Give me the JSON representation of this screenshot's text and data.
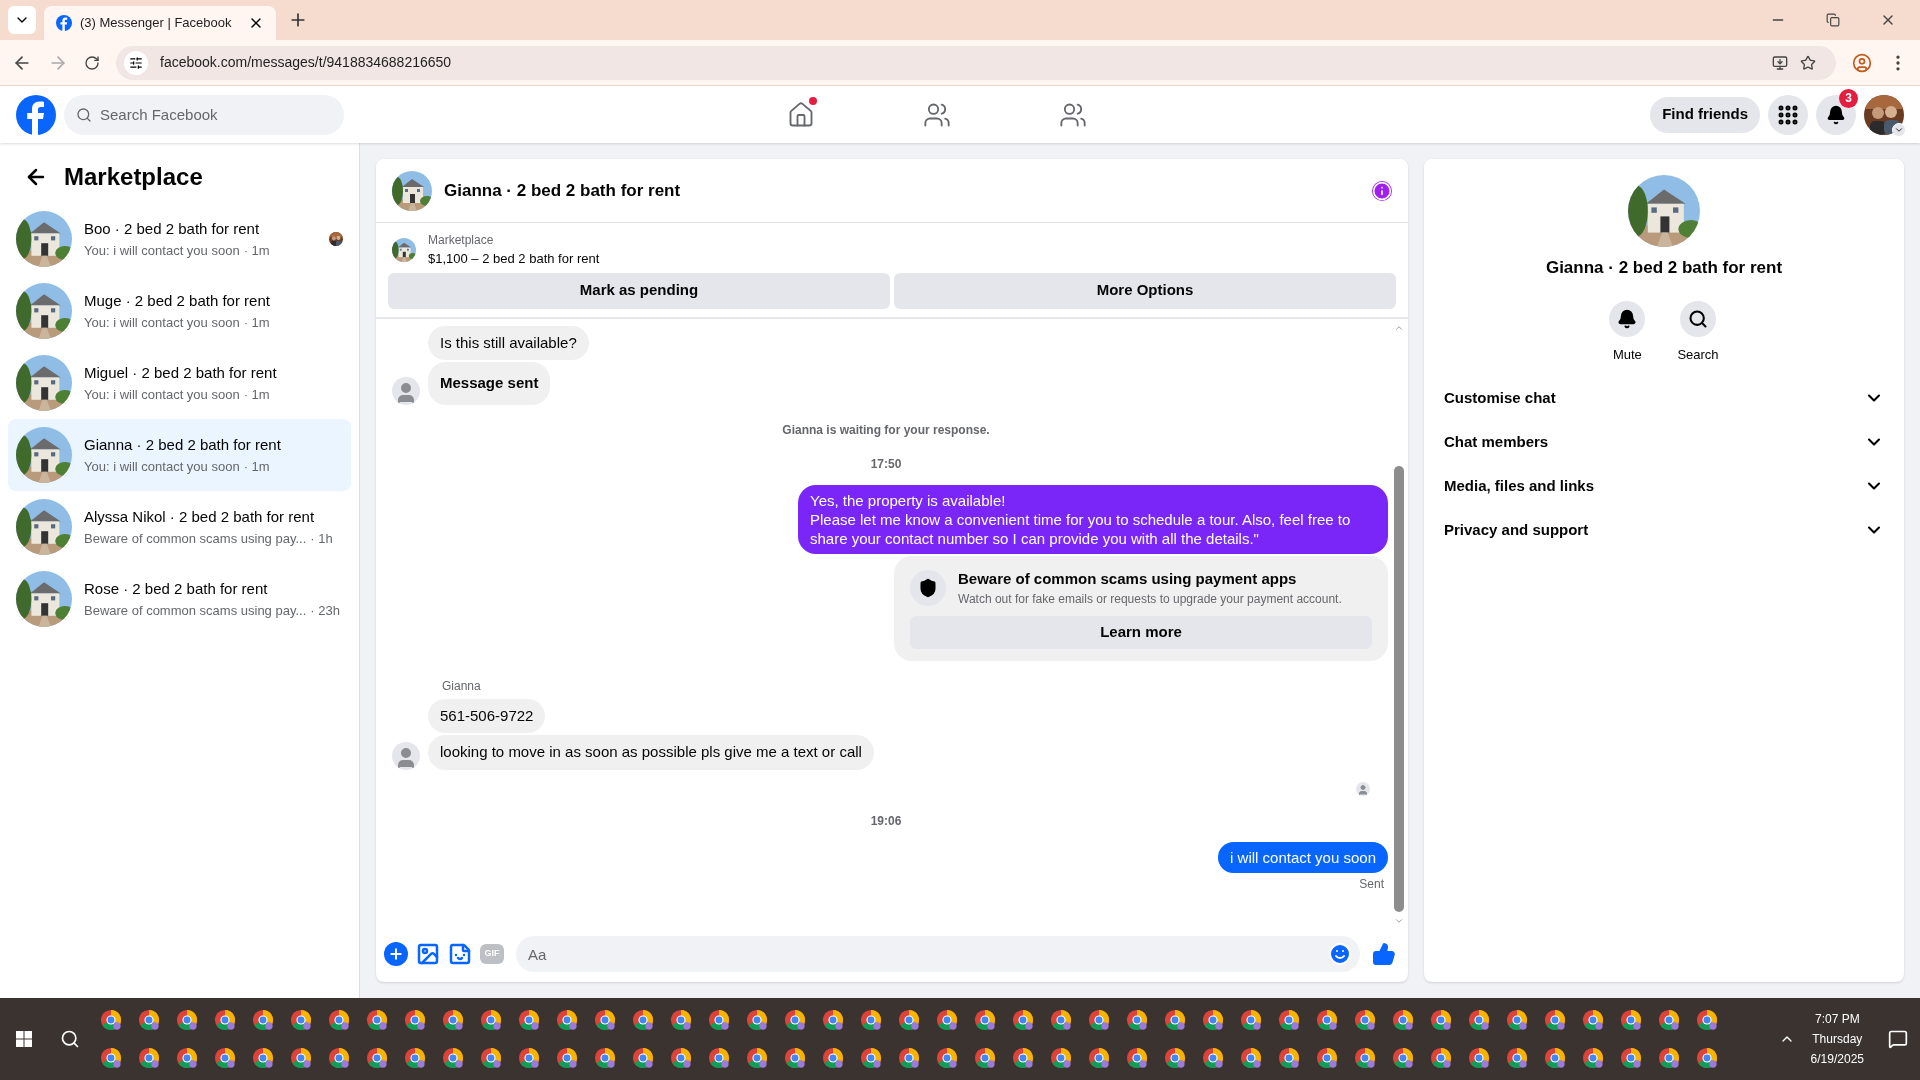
{
  "browser": {
    "tab_title": "(3) Messenger | Facebook",
    "url": "facebook.com/messages/t/9418834688216650"
  },
  "header": {
    "search_placeholder": "Search Facebook",
    "nav": [
      {
        "kind": "home",
        "dot": true
      },
      {
        "kind": "friends",
        "dot": false
      },
      {
        "kind": "groups",
        "dot": false
      }
    ],
    "find_friends": "Find friends",
    "notification_count": "3"
  },
  "sidebar": {
    "title": "Marketplace",
    "conversations": [
      {
        "name": "Boo · 2 bed 2 bath for rent",
        "preview": "You: i will contact you soon",
        "time": "· 1m",
        "selected": false,
        "seen": true
      },
      {
        "name": "Muge · 2 bed 2 bath for rent",
        "preview": "You: i will contact you soon",
        "time": "· 1m",
        "selected": false,
        "seen": false
      },
      {
        "name": "Miguel · 2 bed 2 bath for rent",
        "preview": "You: i will contact you soon",
        "time": "· 1m",
        "selected": false,
        "seen": false
      },
      {
        "name": "Gianna · 2 bed 2 bath for rent",
        "preview": "You: i will contact you soon",
        "time": "· 1m",
        "selected": true,
        "seen": false
      },
      {
        "name": "Alyssa Nikol · 2 bed 2 bath for rent",
        "preview": "Beware of common scams using pay...",
        "time": "· 1h",
        "selected": false,
        "seen": false
      },
      {
        "name": "Rose · 2 bed 2 bath for rent",
        "preview": "Beware of common scams using pay...",
        "time": "· 23h",
        "selected": false,
        "seen": false
      }
    ]
  },
  "chat": {
    "title": "Gianna · 2 bed 2 bath for rent",
    "listing": {
      "label": "Marketplace",
      "price_title": "$1,100 – 2 bed 2 bath for rent"
    },
    "actions": [
      "Mark as pending",
      "More Options"
    ],
    "messages": [
      {
        "kind": "incoming",
        "text": "Is this still available?",
        "bold": false,
        "avatar": false
      },
      {
        "kind": "incoming",
        "text": "Message sent",
        "bold": true,
        "avatar": true
      },
      {
        "kind": "notice",
        "text": "Gianna is waiting for your response."
      },
      {
        "kind": "time",
        "text": "17:50"
      },
      {
        "kind": "outgoing",
        "text": "Yes, the property is available!\nPlease let me know a convenient time for you to schedule a tour. Also, feel free to share your contact number so I can provide you with all the details.\"",
        "color": "#7a26f8"
      },
      {
        "kind": "warning",
        "title": "Beware of common scams using payment apps",
        "body": "Watch out for fake emails or requests to upgrade your payment account.",
        "button": "Learn more"
      },
      {
        "kind": "sender",
        "text": "Gianna"
      },
      {
        "kind": "incoming",
        "text": "561-506-9722",
        "bold": false,
        "avatar": false
      },
      {
        "kind": "incoming",
        "text": "looking to move in as soon as possible pls give me a text or call",
        "bold": false,
        "avatar": true
      },
      {
        "kind": "seen"
      },
      {
        "kind": "time",
        "text": "19:06"
      },
      {
        "kind": "outgoing",
        "text": "i will contact you soon",
        "color": "#0866ff"
      },
      {
        "kind": "status",
        "text": "Sent"
      }
    ],
    "composer": {
      "gif": "GIF",
      "placeholder": "Aa"
    }
  },
  "details": {
    "title": "Gianna · 2 bed 2 bath for rent",
    "actions": [
      {
        "kind": "mute",
        "label": "Mute"
      },
      {
        "kind": "search",
        "label": "Search"
      }
    ],
    "sections": [
      {
        "label": "Customise chat",
        "expanded": false
      },
      {
        "label": "Chat members",
        "expanded": false
      },
      {
        "label": "Media, files and links",
        "expanded": false
      },
      {
        "label": "Privacy and support",
        "expanded": false
      }
    ]
  },
  "taskbar": {
    "time": "7:07 PM",
    "day": "Thursday",
    "date": "6/19/2025"
  }
}
